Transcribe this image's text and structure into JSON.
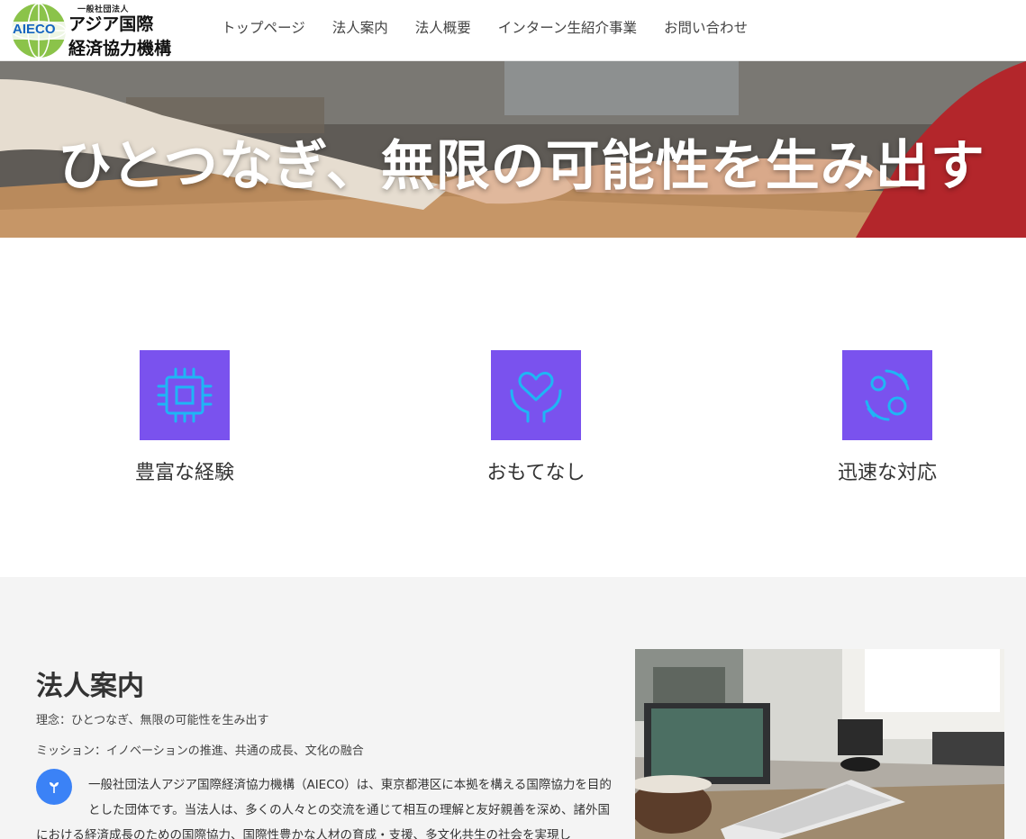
{
  "header": {
    "logo": {
      "small_text": "一般社団法人",
      "badge_text": "AIECO",
      "line1": "アジア国際",
      "line2": "経済協力機構"
    },
    "nav": [
      "トップページ",
      "法人案内",
      "法人概要",
      "インターン生紹介事業",
      "お問い合わせ"
    ]
  },
  "hero": {
    "title": "ひとつなぎ、無限の可能性を生み出す"
  },
  "features": [
    {
      "label": "豊富な経験",
      "icon": "chip-icon"
    },
    {
      "label": "おもてなし",
      "icon": "heart-hands-icon"
    },
    {
      "label": "迅速な対応",
      "icon": "exchange-icon"
    }
  ],
  "about": {
    "title": "法人案内",
    "philosophy": "理念：ひとつなぎ、無限の可能性を生み出す",
    "mission": "ミッション：イノベーションの推進、共通の成長、文化の融合",
    "body": "一般社団法人アジア国際経済協力機構（AIECO）は、東京都港区に本拠を構える国際協力を目的とした団体です。当法人は、多くの人々との交流を通じて相互の理解と友好親善を深め、諸外国における経済成長のための国際協力、国際性豊かな人材の育成・支援、多文化共生の社会を実現し"
  },
  "colors": {
    "accent": "#7a52ee",
    "icon_stroke": "#1fb5f5",
    "badge": "#3b82f6",
    "section_bg": "#f4f4f4"
  }
}
